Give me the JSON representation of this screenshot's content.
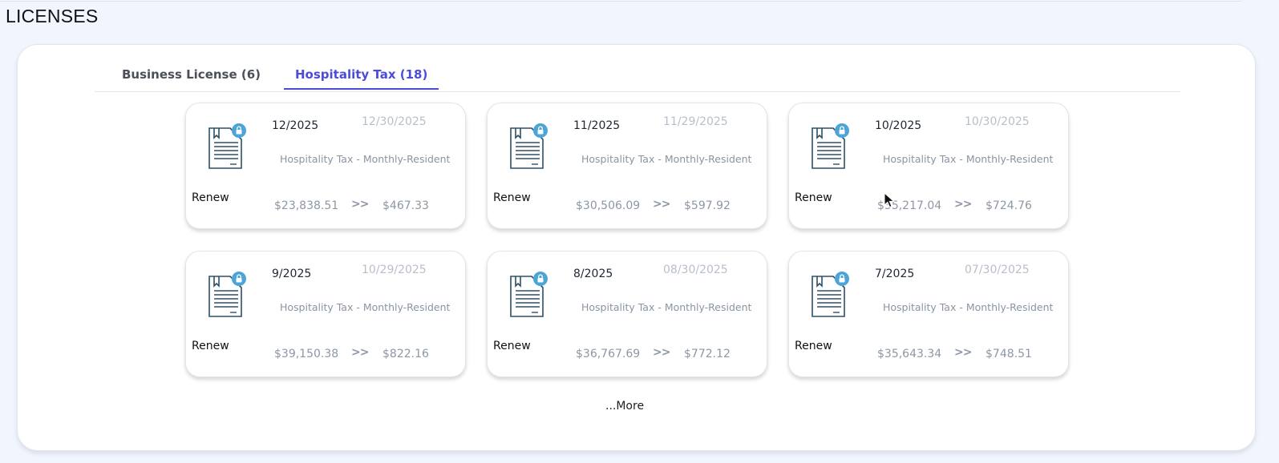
{
  "page": {
    "title": "LICENSES"
  },
  "tabs": [
    {
      "label": "Business License (6)",
      "active": false
    },
    {
      "label": "Hospitality Tax (18)",
      "active": true
    }
  ],
  "colors": {
    "accent": "#4b4cd8",
    "icon": "#2d4f66",
    "lock_badge": "#4ba5d6"
  },
  "cards": [
    {
      "period": "12/2025",
      "due_date": "12/30/2025",
      "type": "Hospitality Tax - Monthly-Resident",
      "action": "Renew",
      "gross": "$23,838.51",
      "arrows": ">>",
      "tax": "$467.33",
      "icon": "document-icon",
      "badge_icon": "lock-icon"
    },
    {
      "period": "11/2025",
      "due_date": "11/29/2025",
      "type": "Hospitality Tax - Monthly-Resident",
      "action": "Renew",
      "gross": "$30,506.09",
      "arrows": ">>",
      "tax": "$597.92",
      "icon": "document-icon",
      "badge_icon": "lock-icon"
    },
    {
      "period": "10/2025",
      "due_date": "10/30/2025",
      "type": "Hospitality Tax - Monthly-Resident",
      "action": "Renew",
      "gross": "$35,217.04",
      "arrows": ">>",
      "tax": "$724.76",
      "icon": "document-icon",
      "badge_icon": "lock-icon"
    },
    {
      "period": "9/2025",
      "due_date": "10/29/2025",
      "type": "Hospitality Tax - Monthly-Resident",
      "action": "Renew",
      "gross": "$39,150.38",
      "arrows": ">>",
      "tax": "$822.16",
      "icon": "document-icon",
      "badge_icon": "lock-icon"
    },
    {
      "period": "8/2025",
      "due_date": "08/30/2025",
      "type": "Hospitality Tax - Monthly-Resident",
      "action": "Renew",
      "gross": "$36,767.69",
      "arrows": ">>",
      "tax": "$772.12",
      "icon": "document-icon",
      "badge_icon": "lock-icon"
    },
    {
      "period": "7/2025",
      "due_date": "07/30/2025",
      "type": "Hospitality Tax - Monthly-Resident",
      "action": "Renew",
      "gross": "$35,643.34",
      "arrows": ">>",
      "tax": "$748.51",
      "icon": "document-icon",
      "badge_icon": "lock-icon"
    }
  ],
  "more": {
    "label": "...More"
  }
}
